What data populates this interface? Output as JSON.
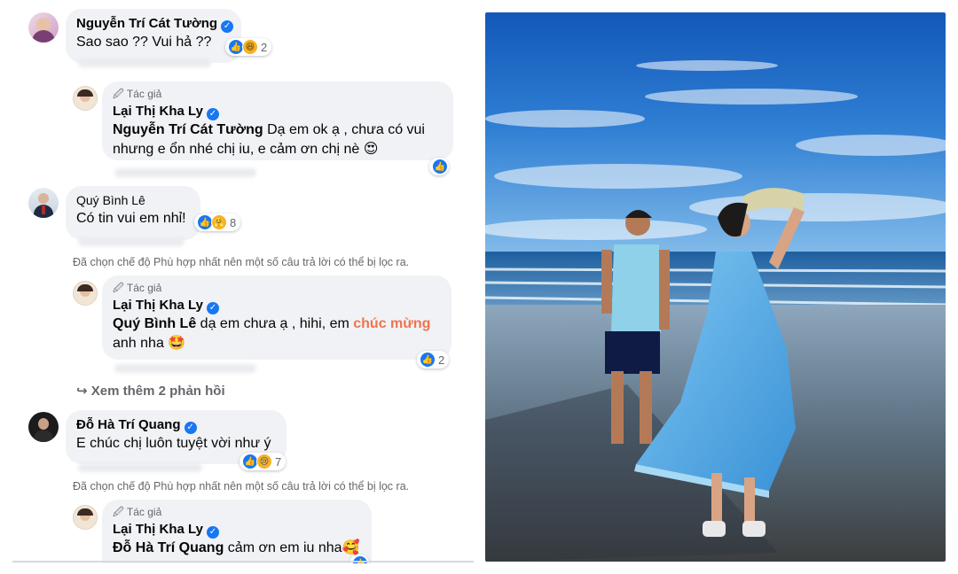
{
  "comments": [
    {
      "author": "Nguyễn Trí Cát Tường",
      "text": "Sao sao ?? Vui hả ??",
      "reaction_count": "2"
    },
    {
      "author": "Quý Bình Lê",
      "text": "Có tin vui em nhỉ!",
      "reaction_count": "8"
    },
    {
      "author": "Đỗ Hà Trí Quang",
      "text": "E chúc chị luôn tuyệt vời như ý",
      "reaction_count": "7"
    }
  ],
  "replies": [
    {
      "badge": "Tác giả",
      "author": "Lại Thị Kha Ly",
      "mention": "Nguyễn Trí Cát Tường",
      "text_line1": " Dạ em ok ạ , chưa có vui",
      "text_line2": "nhưng e ổn nhé chị iu, e cảm ơn chị nè 😍",
      "reaction_count": ""
    },
    {
      "badge": "Tác giả",
      "author": "Lại Thị Kha Ly",
      "mention": "Quý Bình Lê",
      "text_a": " dạ em chưa ạ , hihi, em ",
      "highlight": "chúc mừng",
      "text_line2": "anh nha 🤩",
      "reaction_count": "2"
    },
    {
      "badge": "Tác giả",
      "author": "Lại Thị Kha Ly",
      "mention": "Đỗ Hà Trí Quang",
      "text_a": " cảm ơn em iu nha🥰",
      "reaction_count": ""
    }
  ],
  "filter_note": "Đã chọn chế độ Phù hợp nhất nên một số câu trả lời có thể bị lọc ra.",
  "more_replies": "Xem thêm 2 phản hồi",
  "colors": {
    "bubble": "#f0f2f5",
    "like_blue": "#1877f2",
    "meta_gray": "#65676b",
    "highlight": "#f0734d"
  }
}
